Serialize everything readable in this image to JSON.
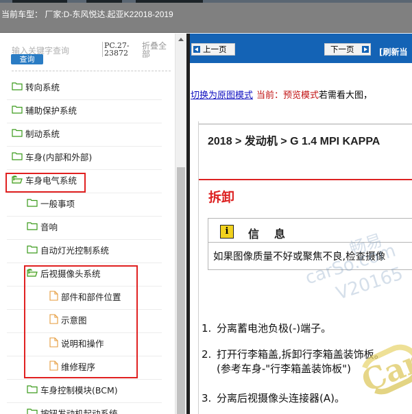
{
  "header": {
    "title": "当前车型： 厂家:D-东风悦达.起亚K22018-2019"
  },
  "search": {
    "placeholder": "输入关键字查询",
    "button_label": "查询",
    "pc_code": "PC.27-23872",
    "collapse_label": "折叠全部"
  },
  "tree": {
    "items": [
      {
        "label": "转向系统",
        "icon": "folder-closed-icon",
        "level": 0
      },
      {
        "label": "辅助保护系统",
        "icon": "folder-closed-icon",
        "level": 0
      },
      {
        "label": "制动系统",
        "icon": "folder-closed-icon",
        "level": 0
      },
      {
        "label": "车身(内部和外部)",
        "icon": "folder-closed-icon",
        "level": 0
      },
      {
        "label": "车身电气系统",
        "icon": "folder-open-icon",
        "level": 0
      },
      {
        "label": "一般事项",
        "icon": "folder-closed-icon",
        "level": 1
      },
      {
        "label": "音响",
        "icon": "folder-closed-icon",
        "level": 1
      },
      {
        "label": "自动灯光控制系统",
        "icon": "folder-closed-icon",
        "level": 1
      },
      {
        "label": "后视摄像头系统",
        "icon": "folder-open-icon",
        "level": 1
      },
      {
        "label": "部件和部件位置",
        "icon": "document-icon",
        "level": 2
      },
      {
        "label": "示意图",
        "icon": "document-icon",
        "level": 2
      },
      {
        "label": "说明和操作",
        "icon": "document-icon",
        "level": 2
      },
      {
        "label": "维修程序",
        "icon": "document-icon",
        "level": 2
      },
      {
        "label": "车身控制模块(BCM)",
        "icon": "folder-closed-icon",
        "level": 1
      },
      {
        "label": "按钮发动机起动系统",
        "icon": "folder-closed-icon",
        "level": 1
      }
    ]
  },
  "toolbar": {
    "prev_label": "上一页",
    "next_label": "下一页",
    "refresh_label": "[刷新当"
  },
  "mode": {
    "switch_link": "切换为原图模式",
    "current_label": "当前：预览模式",
    "hint": "若需看大图，"
  },
  "doc": {
    "breadcrumb": "2018 > 发动机 > G 1.4 MPI KAPPA",
    "section_title": "拆卸",
    "info_icon": "i",
    "info_label": "信息",
    "info_text": "如果图像质量不好或聚焦不良,检查摄像",
    "steps": [
      {
        "num": "1.",
        "text": "分离蓄电池负极(-)端子。"
      },
      {
        "num": "2.",
        "text": "打开行李箱盖,拆卸行李箱盖装饰板。",
        "text2": "(参考车身-\"行李箱盖装饰板\")"
      },
      {
        "num": "3.",
        "text": "分离后视摄像头连接器(A)。"
      }
    ]
  },
  "watermark": {
    "line1": "畅易",
    "line2": "carSo.com",
    "line3": "V20165",
    "logo": "Car"
  },
  "colors": {
    "header_bg": "#808080",
    "toolbar_bg": "#1463b5",
    "highlight_red": "#e02020",
    "section_red": "#dd2222",
    "info_yellow": "#f2d21d"
  }
}
